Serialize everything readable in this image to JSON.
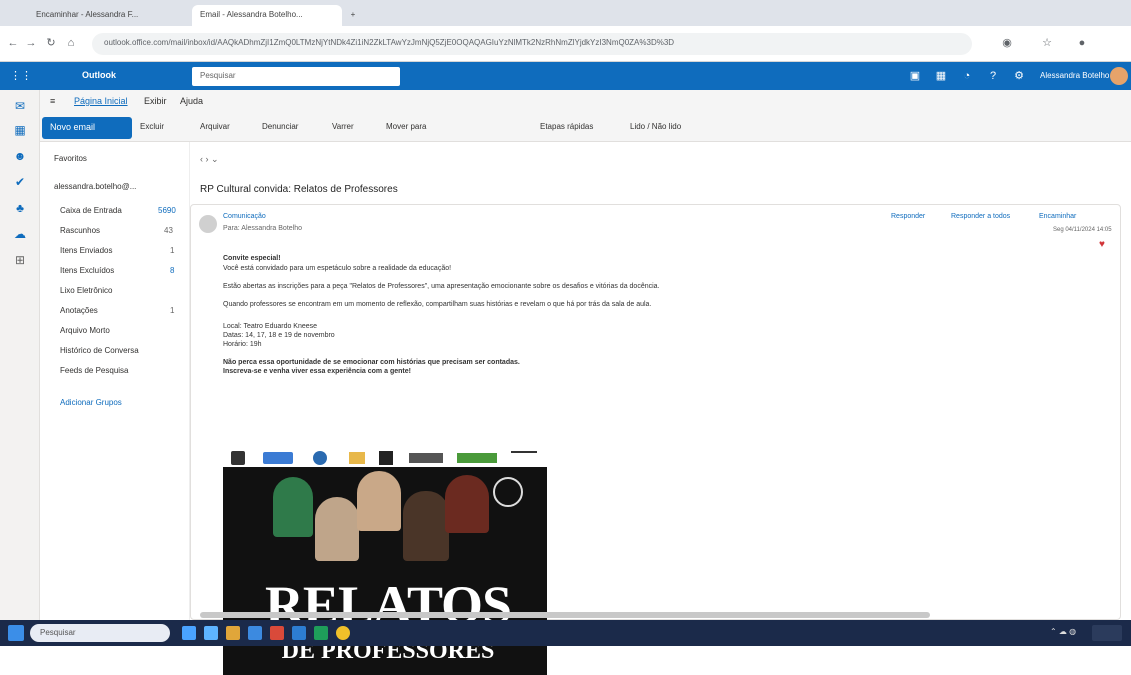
{
  "browser": {
    "tabs": [
      {
        "label": "Encaminhar - Alessandra F..."
      },
      {
        "label": "Email - Alessandra Botelho..."
      }
    ],
    "url": "outlook.office.com/mail/inbox/id/AAQkADhmZjI1ZmQ0LTMzNjYtNDk4Zi1iN2ZkLTAwYzJmNjQ5ZjE0OQAQAGIuYzNlMTk2NzRhNmZlYjdkYzI3NmQ0ZA%3D%3D"
  },
  "outlook": {
    "app_name": "Outlook",
    "search_placeholder": "Pesquisar",
    "user_name": "Alessandra Botelho"
  },
  "ribbon": {
    "tabs": [
      "Página Inicial",
      "Exibir",
      "Ajuda"
    ],
    "new_mail_label": "Novo email",
    "buttons": [
      "Excluir",
      "Arquivar",
      "Denunciar",
      "Varrer",
      "Mover para",
      "Etapas rápidas",
      "Lido / Não lido"
    ]
  },
  "folders": {
    "favorites_label": "Favoritos",
    "account_label": "alessandra.botelho@...",
    "items": [
      {
        "label": "Caixa de Entrada",
        "count": "5690"
      },
      {
        "label": "Rascunhos",
        "count": "43"
      },
      {
        "label": "Itens Enviados",
        "count": "1"
      },
      {
        "label": "Itens Excluídos",
        "count": "8"
      },
      {
        "label": "Lixo Eletrônico",
        "count": ""
      },
      {
        "label": "Anotações",
        "count": "1"
      },
      {
        "label": "Arquivo Morto",
        "count": ""
      },
      {
        "label": "Histórico de Conversa",
        "count": ""
      },
      {
        "label": "Feeds de Pesquisa",
        "count": ""
      },
      {
        "label": "Adicionar Grupos",
        "count": ""
      }
    ]
  },
  "message": {
    "subject": "RP Cultural convida: Relatos de Professores",
    "sender": "Comunicação",
    "recipient": "Para: Alessandra Botelho",
    "actions": [
      "Responder",
      "Responder a todos",
      "Encaminhar"
    ],
    "date": "Seg 04/11/2024 14:05",
    "body": [
      "Convite especial!",
      "Você está convidado para um espetáculo sobre a realidade da educação!",
      "Estão abertas as inscrições para a peça \"Relatos de Professores\", uma apresentação emocionante sobre os desafios e vitórias da docência.",
      "Quando professores se encontram em um momento de reflexão, compartilham suas histórias e revelam o que há por trás da sala de aula.",
      "Local: Teatro Eduardo Kneese",
      "Datas: 14, 17, 18 e 19 de novembro",
      "Horário: 19h",
      "Não perca essa oportunidade de se emocionar com histórias que precisam ser contadas.",
      "Inscreva-se e venha viver essa experiência com a gente!"
    ],
    "poster_title": "RELATOS",
    "poster_subtitle": "DE PROFESSORES"
  },
  "taskbar": {
    "search_placeholder": "Pesquisar"
  }
}
